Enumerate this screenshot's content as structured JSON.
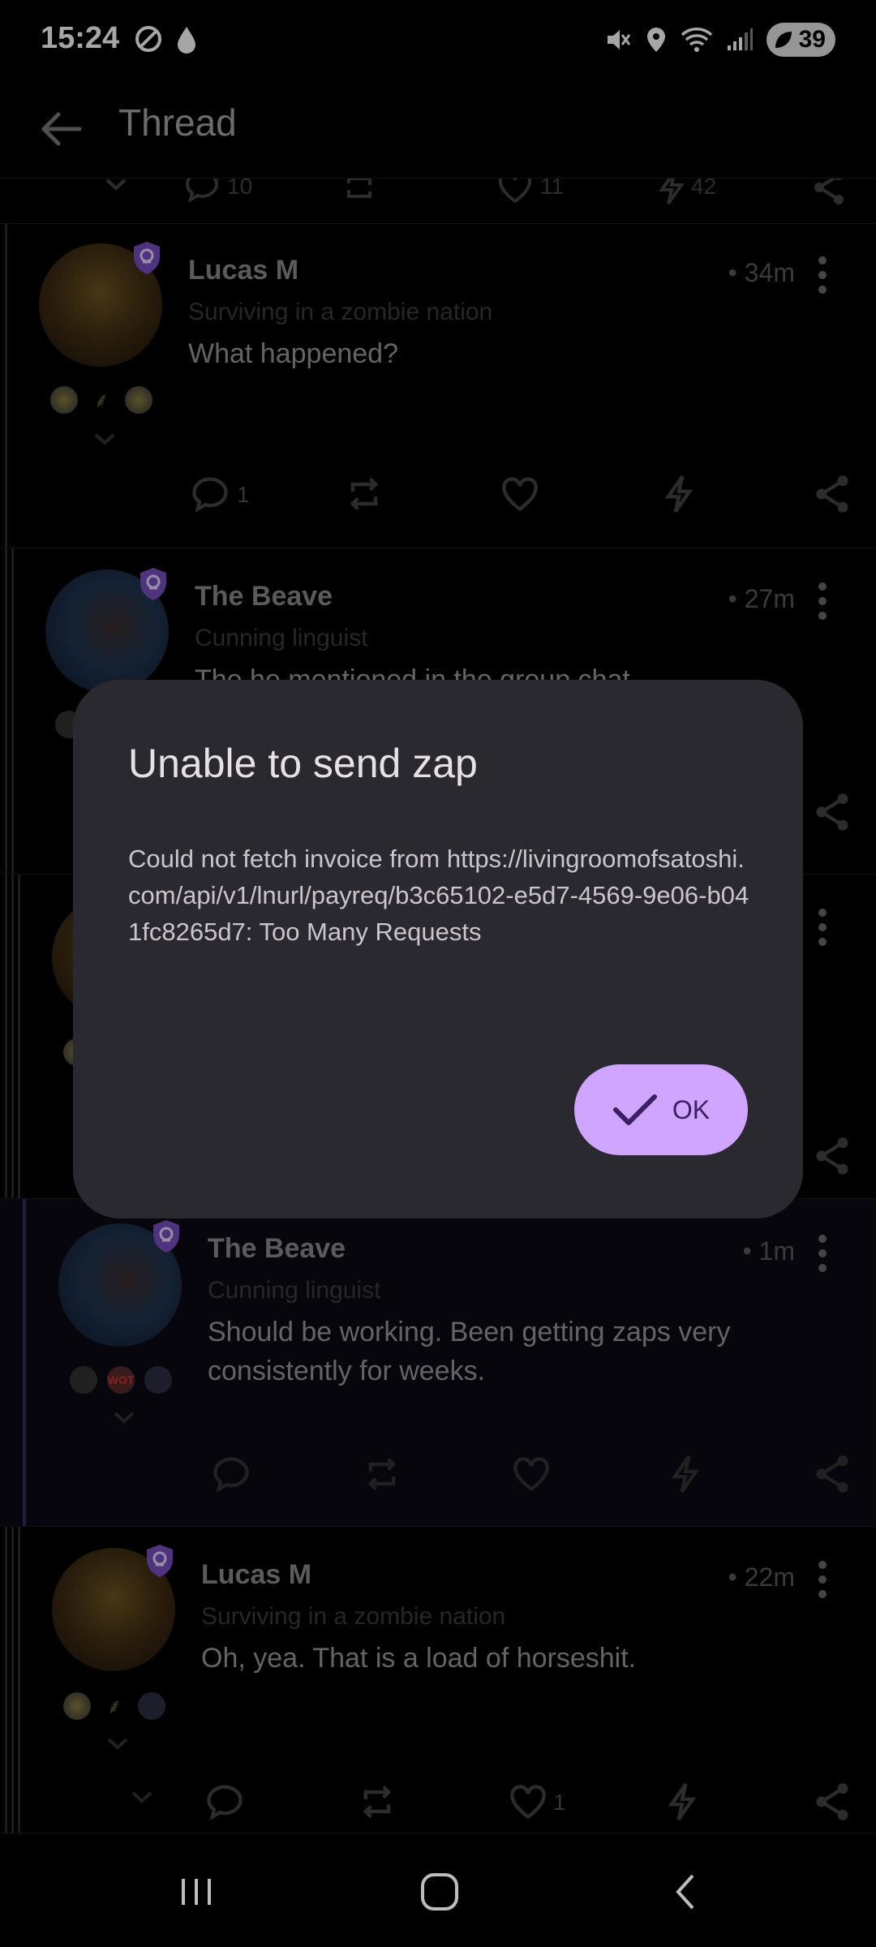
{
  "status_bar": {
    "time": "15:24",
    "battery": "39"
  },
  "top_bar": {
    "title": "Thread"
  },
  "top_action_row": {
    "reply_count": "10",
    "like_count": "11",
    "zap_count": "42"
  },
  "posts": [
    {
      "author": "Lucas M",
      "about": "Surviving in a zombie nation",
      "time": "• 34m",
      "text": "What happened?",
      "reply_count": "1",
      "like_count": ""
    },
    {
      "author": "The Beave",
      "about": "Cunning linguist",
      "time": "• 27m",
      "text": "The he mentioned in the group chat",
      "reply_count": "",
      "like_count": ""
    },
    {
      "author": "The Beave",
      "about": "Cunning linguist",
      "time": "• 1m",
      "text": "Should be working. Been getting zaps very consistently for weeks.",
      "reply_count": "",
      "like_count": ""
    },
    {
      "author": "Lucas M",
      "about": "Surviving in a zombie nation",
      "time": "• 22m",
      "text": "Oh, yea. That is a load of horseshit.",
      "reply_count": "",
      "like_count": "1"
    }
  ],
  "badges": {
    "wot": "WOT"
  },
  "dialog": {
    "title": "Unable to send zap",
    "body": "Could not fetch invoice from https://livingroomofsatoshi.com/api/v1/lnurl/payreq/b3c65102-e5d7-4569-9e06-b041fc8265d7: Too Many Requests",
    "ok_label": "OK"
  },
  "colors": {
    "accent": "#cfa5ff",
    "dialog_bg": "#2b2930",
    "shield": "#7a4fc4"
  }
}
